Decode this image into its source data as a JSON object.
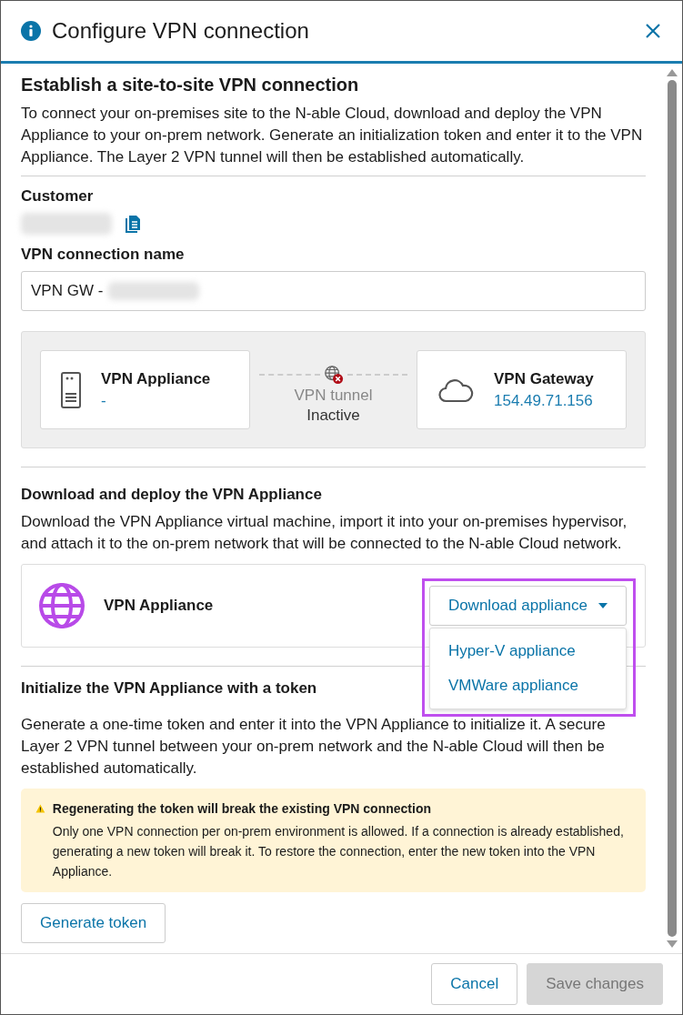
{
  "dialog": {
    "title": "Configure VPN connection"
  },
  "intro": {
    "heading": "Establish a site-to-site VPN connection",
    "text": "To connect your on-premises site to the N-able Cloud, download and deploy the VPN Appliance to your on-prem network. Generate an initialization token and enter it to the VPN Appliance. The Layer 2 VPN tunnel will then be established automatically."
  },
  "customer": {
    "label": "Customer"
  },
  "connection_name": {
    "label": "VPN connection name",
    "value": "VPN GW -"
  },
  "topology": {
    "appliance": {
      "name": "VPN Appliance",
      "value": "-"
    },
    "tunnel": {
      "label": "VPN tunnel",
      "status": "Inactive",
      "active": false
    },
    "gateway": {
      "name": "VPN Gateway",
      "value": "154.49.71.156"
    }
  },
  "download": {
    "heading": "Download and deploy the VPN Appliance",
    "text": "Download the VPN Appliance virtual machine, import it into your on-premises hypervisor, and attach it to the on-prem network that will be connected to the N-able Cloud network.",
    "item": {
      "name": "VPN Appliance"
    },
    "button": "Download appliance",
    "menu": {
      "expanded": true,
      "items": [
        "Hyper-V appliance",
        "VMWare appliance"
      ]
    }
  },
  "token": {
    "heading": "Initialize the VPN Appliance with a token",
    "text": "Generate a one-time token and enter it into the VPN Appliance to initialize it. A secure Layer 2 VPN tunnel between your on-prem network and the N-able Cloud will then be established automatically.",
    "warning": {
      "title": "Regenerating the token will break the existing VPN connection",
      "text": "Only one VPN connection per on-prem environment is allowed. If a connection is already established, generating a new token will break it. To restore the connection, enter the new token into the VPN Appliance."
    },
    "button": "Generate token"
  },
  "footer": {
    "buttons": [
      {
        "label": "Cancel",
        "disabled": false
      },
      {
        "label": "Save changes",
        "disabled": true
      }
    ]
  }
}
